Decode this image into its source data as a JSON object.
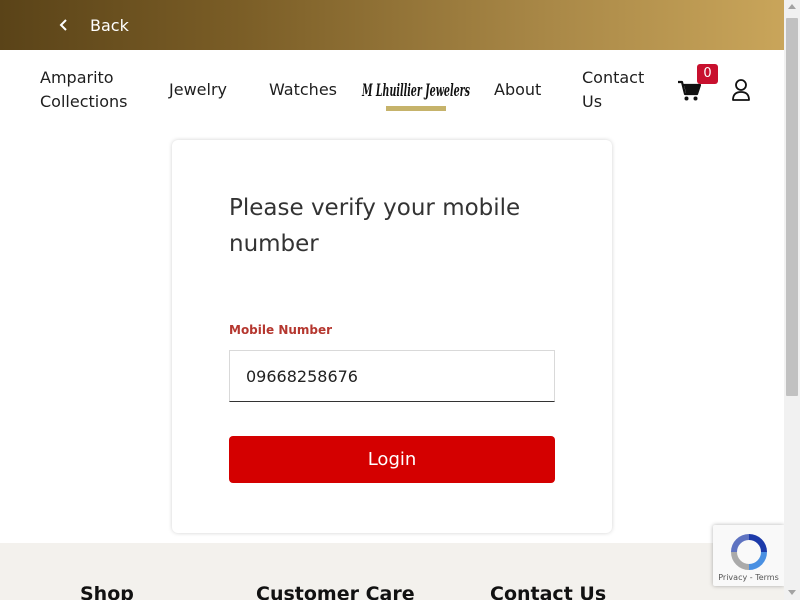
{
  "topbar": {
    "back_label": "Back"
  },
  "nav": {
    "amparito_line1": "Amparito",
    "amparito_line2": "Collections",
    "jewelry": "Jewelry",
    "watches": "Watches",
    "logo_text": "M Lhuillier Jewelers",
    "about": "About",
    "contact_line1": "Contact",
    "contact_line2": "Us",
    "cart_count": "0"
  },
  "verify": {
    "title": "Please verify your mobile number",
    "mobile_label": "Mobile Number",
    "mobile_value": "09668258676",
    "login_label": "Login"
  },
  "footer": {
    "shop": "Shop",
    "customer_care": "Customer Care",
    "contact_us": "Contact Us"
  },
  "recaptcha": {
    "privacy": "Privacy",
    "terms": "Terms"
  },
  "colors": {
    "accent_red": "#d40000",
    "label_red": "#b5372f",
    "gold_dark": "#5a4318",
    "gold_light": "#c9a55a"
  }
}
